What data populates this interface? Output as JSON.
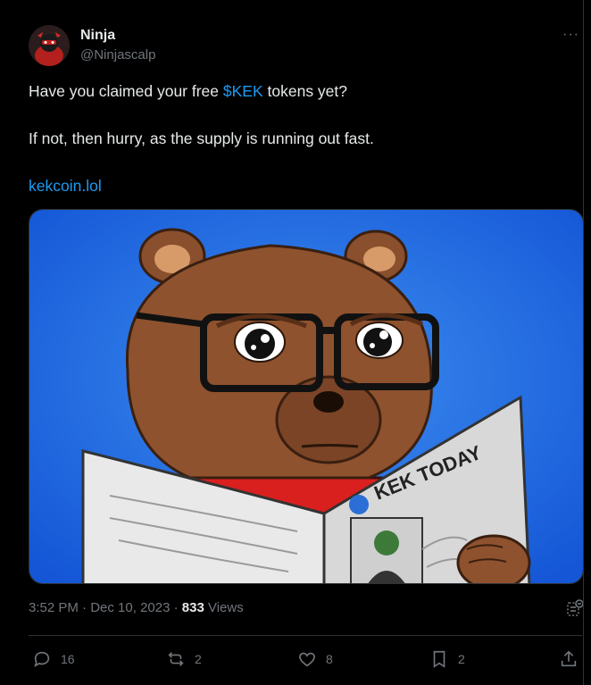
{
  "author": {
    "name": "Ninja",
    "handle": "@Ninjascalp"
  },
  "more_label": "···",
  "tweet": {
    "line1_before": "Have you claimed your free ",
    "line1_cashtag": "$KEK",
    "line1_after": " tokens yet?",
    "line2": "If not, then hurry, as the supply is running out fast.",
    "link": "kekcoin.lol"
  },
  "media": {
    "newspaper_headline": "KEK TODAY"
  },
  "meta": {
    "time": "3:52 PM",
    "separator1": " · ",
    "date": "Dec 10, 2023",
    "separator2": " · ",
    "views": "833",
    "views_label": " Views"
  },
  "actions": {
    "replies": "16",
    "reposts": "2",
    "likes": "8",
    "bookmarks": "2"
  },
  "colors": {
    "accent": "#1d9bf0",
    "background": "#000000",
    "muted": "#71767b"
  }
}
